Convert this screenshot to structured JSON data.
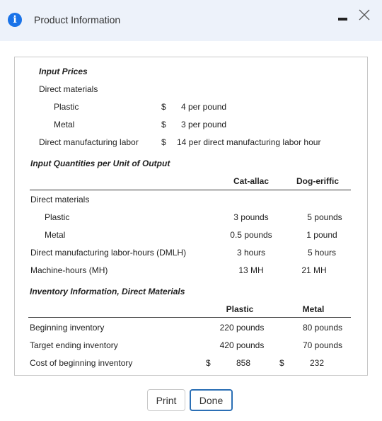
{
  "dialog": {
    "title": "Product Information",
    "info_glyph": "i"
  },
  "input_prices": {
    "heading": "Input Prices",
    "direct_materials_label": "Direct materials",
    "plastic": {
      "label": "Plastic",
      "currency": "$",
      "value": "4 per pound"
    },
    "metal": {
      "label": "Metal",
      "currency": "$",
      "value": "3 per pound"
    },
    "labor": {
      "label": "Direct manufacturing labor",
      "currency": "$",
      "value": "14 per direct manufacturing labor hour"
    }
  },
  "input_quantities": {
    "heading": "Input Quantities per Unit of Output",
    "columns": [
      "Cat-allac",
      "Dog-eriffic"
    ],
    "direct_materials_label": "Direct materials",
    "rows": [
      {
        "label": "Plastic",
        "values": [
          "3 pounds",
          "5 pounds"
        ]
      },
      {
        "label": "Metal",
        "values": [
          "0.5 pounds",
          "1 pound"
        ]
      },
      {
        "label": "Direct manufacturing labor-hours (DMLH)",
        "values": [
          "3 hours",
          "5 hours"
        ]
      },
      {
        "label": "Machine-hours (MH)",
        "values": [
          "13 MH",
          "21 MH"
        ]
      }
    ]
  },
  "inventory": {
    "heading": "Inventory Information, Direct Materials",
    "columns": [
      "Plastic",
      "Metal"
    ],
    "rows": [
      {
        "label": "Beginning inventory",
        "values": [
          "220 pounds",
          "80 pounds"
        ]
      },
      {
        "label": "Target ending inventory",
        "values": [
          "420 pounds",
          "70 pounds"
        ]
      }
    ],
    "cost_row": {
      "label": "Cost of beginning inventory",
      "currency": "$",
      "values": [
        "858",
        "232"
      ]
    }
  },
  "buttons": {
    "print": "Print",
    "done": "Done"
  },
  "colors": {
    "header_bg": "#edf2fa",
    "info_icon": "#1a73e8",
    "done_border": "#2b6fb5"
  }
}
